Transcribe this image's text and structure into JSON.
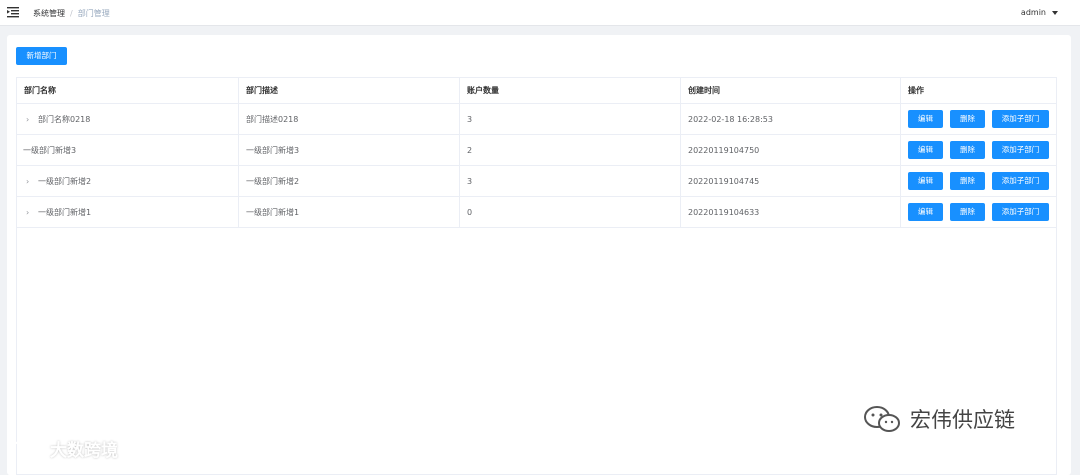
{
  "header": {
    "breadcrumb": [
      "系统管理",
      "部门管理"
    ],
    "breadcrumb_sep": "/",
    "user": "admin"
  },
  "toolbar": {
    "add_label": "新增部门"
  },
  "table": {
    "columns": [
      "部门名称",
      "部门描述",
      "账户数量",
      "创建时间",
      "操作"
    ],
    "rows": [
      {
        "name": "部门名称0218",
        "desc": "部门描述0218",
        "count": "3",
        "created": "2022-02-18 16:28:53",
        "expandable": true
      },
      {
        "name": "一级部门新增3",
        "desc": "一级部门新增3",
        "count": "2",
        "created": "20220119104750",
        "expandable": false
      },
      {
        "name": "一级部门新增2",
        "desc": "一级部门新增2",
        "count": "3",
        "created": "20220119104745",
        "expandable": true
      },
      {
        "name": "一级部门新增1",
        "desc": "一级部门新增1",
        "count": "0",
        "created": "20220119104633",
        "expandable": true
      }
    ],
    "actions": {
      "edit": "编辑",
      "delete": "删除",
      "add_child": "添加子部门"
    }
  },
  "watermarks": {
    "left": "大数跨境",
    "right": "宏伟供应链"
  },
  "colors": {
    "primary": "#1890ff",
    "background": "#f0f2f5"
  }
}
